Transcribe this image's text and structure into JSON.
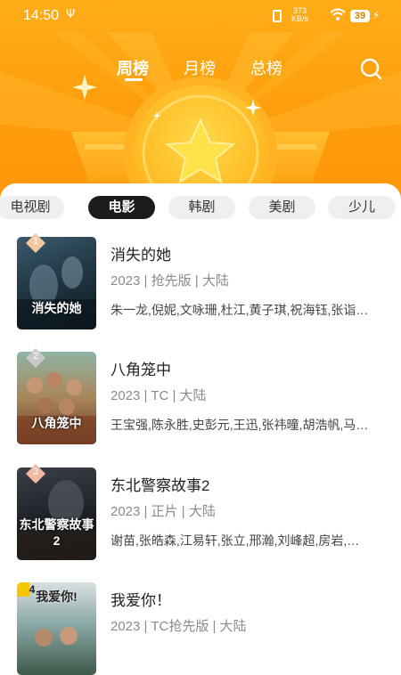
{
  "status_bar": {
    "time": "14:50",
    "usb": "Ψ",
    "net_speed": "373",
    "net_unit": "KB/s",
    "battery": "39"
  },
  "header": {
    "tabs": [
      {
        "label": "周榜",
        "active": true
      },
      {
        "label": "月榜",
        "active": false
      },
      {
        "label": "总榜",
        "active": false
      }
    ],
    "search_icon": "search-icon"
  },
  "categories": [
    {
      "label": "电视剧",
      "active": false
    },
    {
      "label": "电影",
      "active": true
    },
    {
      "label": "韩剧",
      "active": false
    },
    {
      "label": "美剧",
      "active": false
    },
    {
      "label": "少儿",
      "active": false
    }
  ],
  "movies": [
    {
      "rank": "1",
      "title": "消失的她",
      "meta": "2023 | 抢先版 | 大陆",
      "cast": "朱一龙,倪妮,文咏珊,杜江,黄子琪,祝海钰,张诣…",
      "poster_text": "消失的她"
    },
    {
      "rank": "2",
      "title": "八角笼中",
      "meta": "2023 | TC | 大陆",
      "cast": "王宝强,陈永胜,史彭元,王迅,张祎曈,胡浩帆,马…",
      "poster_text": "八角笼中"
    },
    {
      "rank": "3",
      "title": "东北警察故事2",
      "meta": "2023 | 正片 | 大陆",
      "cast": "谢苗,张皓森,江易轩,张立,邢瀚,刘峰超,房岩,…",
      "poster_text": "东北警察故事2"
    },
    {
      "rank": "4",
      "title": "我爱你！",
      "meta": "2023 | TC抢先版 | 大陆",
      "cast": "",
      "poster_text": "我爱你!"
    }
  ],
  "colors": {
    "accent": "#ff9d0c",
    "rank_1": "#f4c7a0",
    "rank_2": "#c9c9c9",
    "rank_3": "#f3b9a5"
  }
}
